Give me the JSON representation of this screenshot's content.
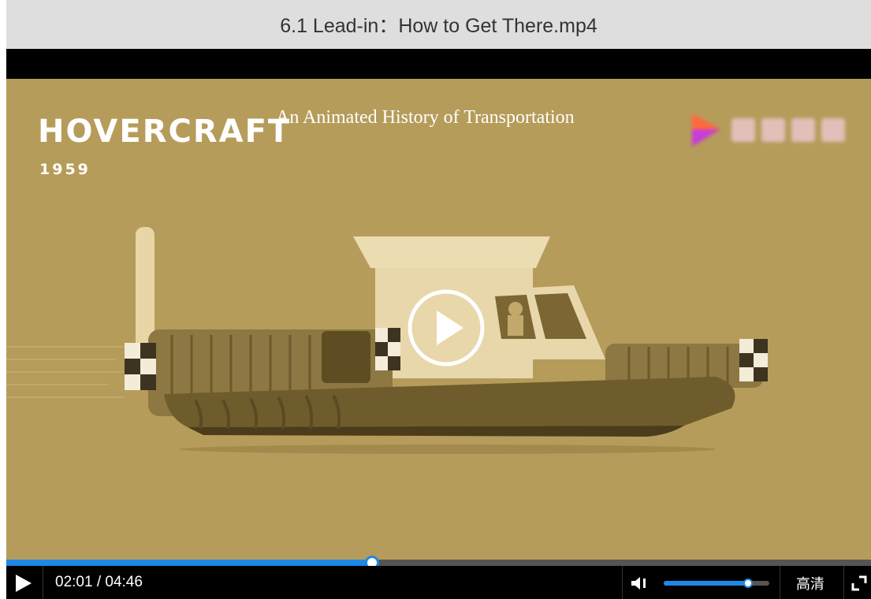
{
  "window": {
    "title": "6.1 Lead-in：How to Get There.mp4"
  },
  "video": {
    "overlay_title": "An Animated History of Transportation",
    "headline": "HOVERCRAFT",
    "headline_year": "1959",
    "watermark_icon": "video-platform-logo-icon",
    "background_color": "#b69c5a"
  },
  "player": {
    "current_time": "02:01",
    "duration": "04:46",
    "time_readout": "02:01 / 04:46",
    "progress_fraction": 0.423,
    "volume_fraction": 0.8,
    "quality_label": "高清",
    "accent_color": "#1e88e5",
    "icons": {
      "big_play": "play-circle-icon",
      "play": "play-icon",
      "volume": "volume-icon",
      "fullscreen": "fullscreen-icon"
    }
  }
}
